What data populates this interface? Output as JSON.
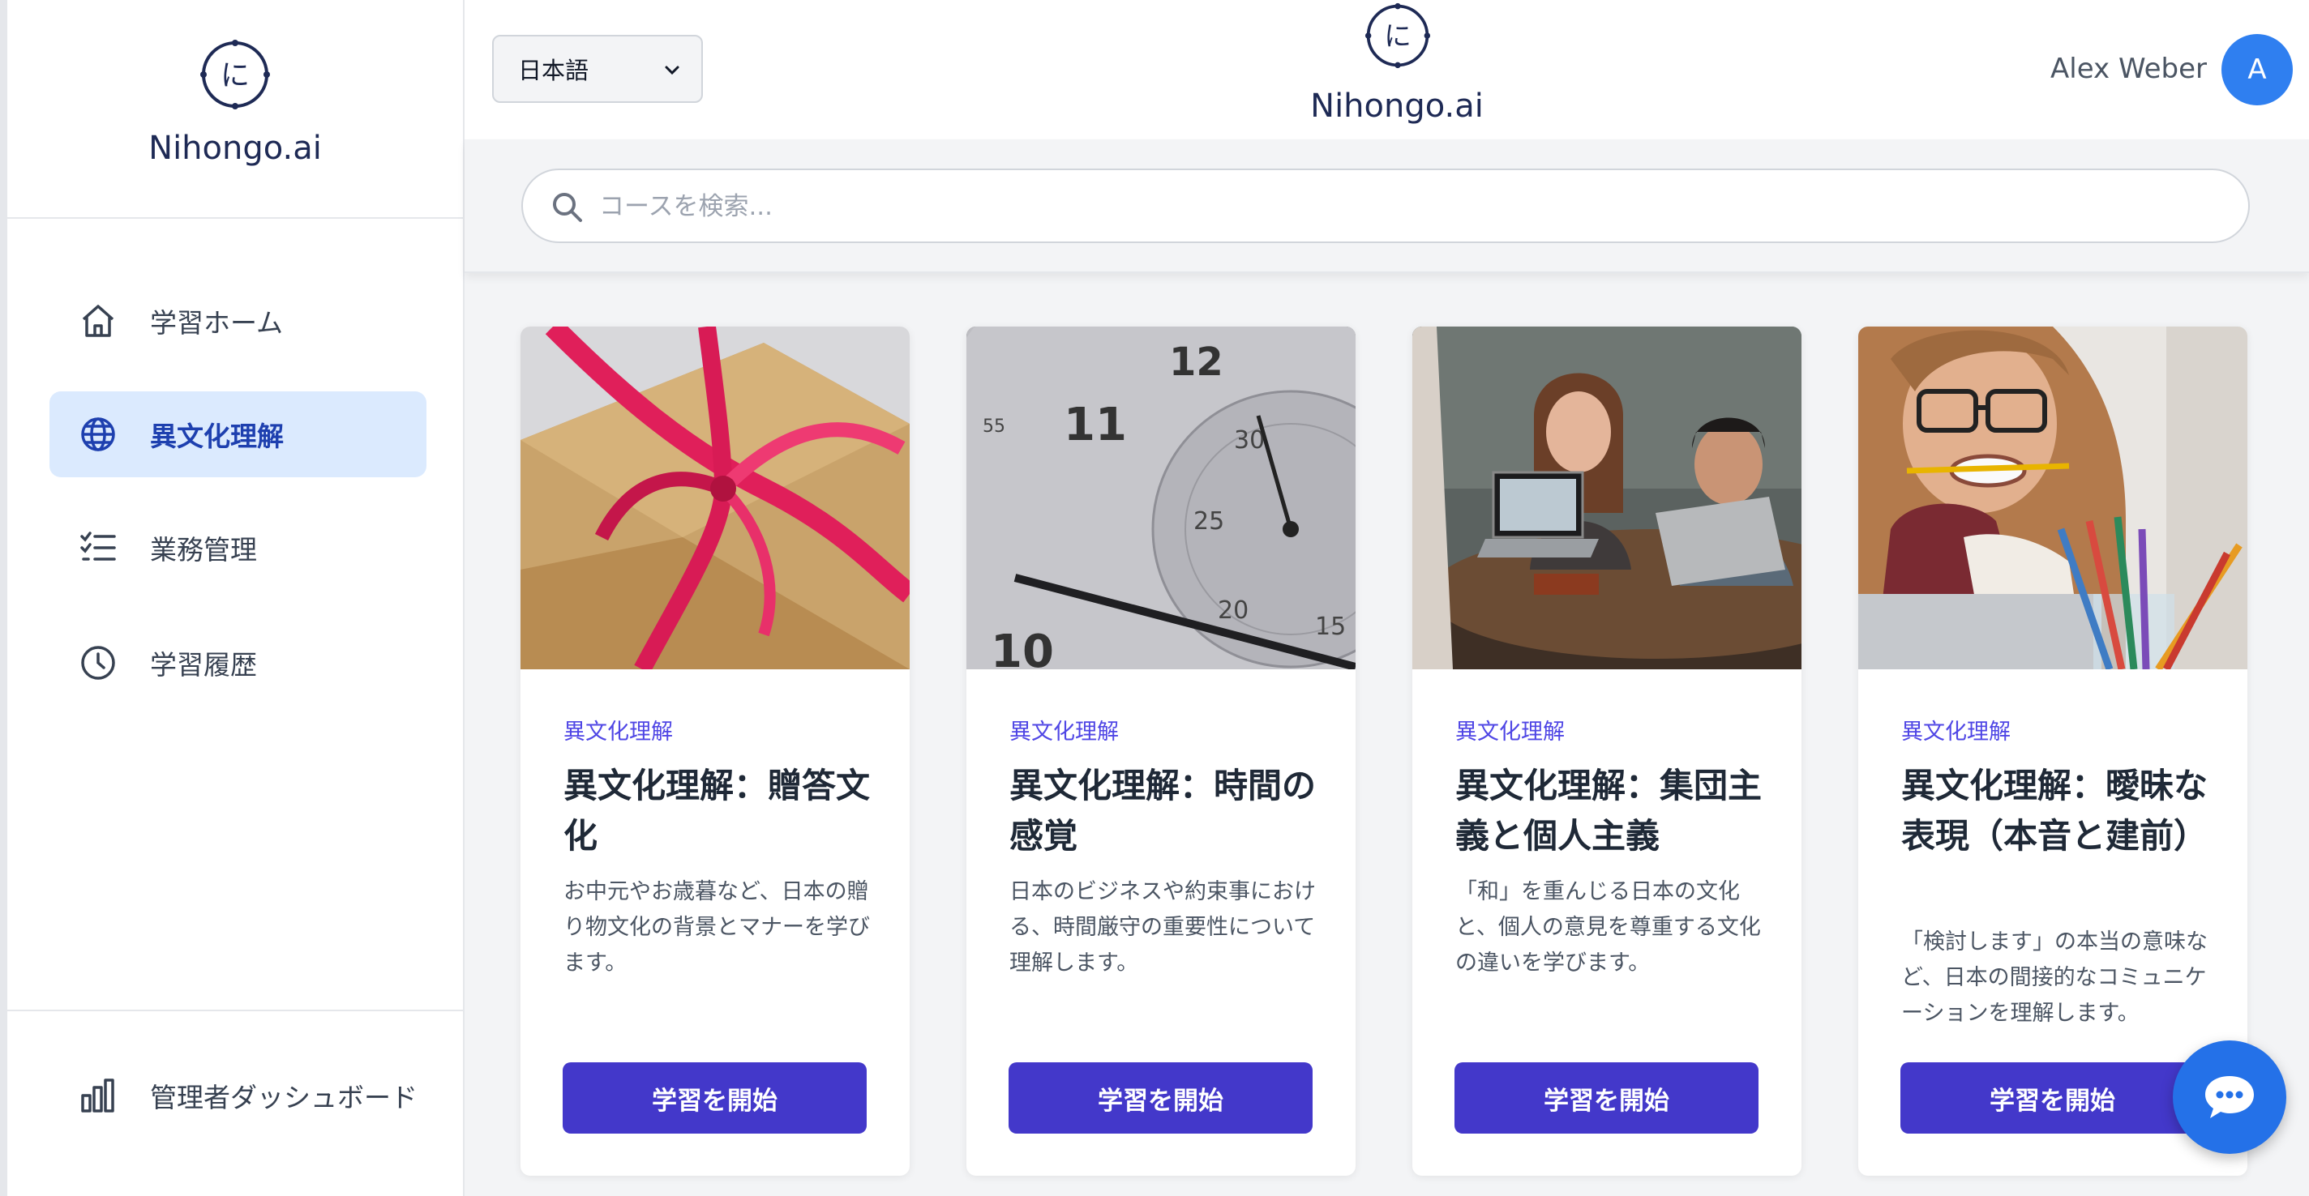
{
  "brand": {
    "name": "Nihongo.ai",
    "logo_glyph": "に"
  },
  "sidebar": {
    "items": [
      {
        "label": "学習ホーム",
        "icon": "home-icon",
        "active": false
      },
      {
        "label": "異文化理解",
        "icon": "globe-icon",
        "active": true
      },
      {
        "label": "業務管理",
        "icon": "checklist-icon",
        "active": false
      },
      {
        "label": "学習履歴",
        "icon": "clock-icon",
        "active": false
      }
    ],
    "admin": {
      "label": "管理者ダッシュボード",
      "icon": "bar-chart-icon"
    }
  },
  "header": {
    "language": "日本語",
    "brand": "Nihongo.ai",
    "logo_glyph": "に",
    "user_name": "Alex Weber",
    "avatar_initial": "A"
  },
  "search": {
    "placeholder": "コースを検索..."
  },
  "cards": [
    {
      "category": "異文化理解",
      "title": "異文化理解：贈答文化",
      "description": "お中元やお歳暮など、日本の贈り物文化の背景とマナーを学びます。",
      "button": "学習を開始",
      "image": "gift-ribbon-photo"
    },
    {
      "category": "異文化理解",
      "title": "異文化理解：時間の感覚",
      "description": "日本のビジネスや約束事における、時間厳守の重要性について理解します。",
      "button": "学習を開始",
      "image": "clock-face-photo"
    },
    {
      "category": "異文化理解",
      "title": "異文化理解：集団主義と個人主義",
      "description": "「和」を重んじる日本の文化と、個人の意見を尊重する文化の違いを学びます。",
      "button": "学習を開始",
      "image": "group-meeting-photo"
    },
    {
      "category": "異文化理解",
      "title": "異文化理解：曖昧な表現（本音と建前）",
      "description": "「検討します」の本当の意味など、日本の間接的なコミュニケーションを理解します。",
      "button": "学習を開始",
      "image": "woman-pencil-photo"
    }
  ],
  "colors": {
    "accent": "#4338ca",
    "active_nav_bg": "#dbeafe",
    "avatar": "#2f7ff0",
    "chat": "#2471e8"
  },
  "chat": {
    "icon": "chat-bubble-icon"
  }
}
